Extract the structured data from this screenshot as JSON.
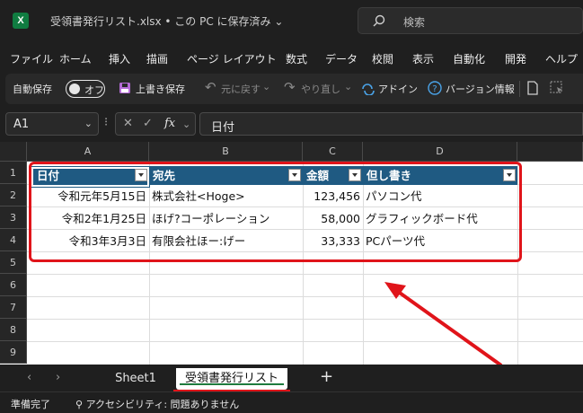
{
  "titlebar": {
    "app_icon": "X",
    "file_title": "受領書発行リスト.xlsx • この PC に保存済み ⌄",
    "search_placeholder": "検索"
  },
  "menu": [
    "ファイル",
    "ホーム",
    "挿入",
    "描画",
    "ページ レイアウト",
    "数式",
    "データ",
    "校閲",
    "表示",
    "自動化",
    "開発",
    "ヘルプ"
  ],
  "ribbon": {
    "autosave_label": "自動保存",
    "autosave_state": "オフ",
    "save_label": "上書き保存",
    "undo_label": "元に戻す",
    "redo_label": "やり直し",
    "addin_label": "アドイン",
    "version_label": "バージョン情報"
  },
  "formula_bar": {
    "name_box": "A1",
    "formula": "日付"
  },
  "grid": {
    "columns": [
      "A",
      "B",
      "C",
      "D"
    ],
    "rows": [
      "1",
      "2",
      "3",
      "4",
      "5",
      "6",
      "7",
      "8",
      "9"
    ],
    "table_headers": [
      "日付",
      "宛先",
      "金額",
      "但し書き"
    ],
    "table_rows": [
      [
        "令和元年5月15日",
        "株式会社<Hoge>",
        "123,456",
        "パソコン代"
      ],
      [
        "令和2年1月25日",
        "ほげ?コーポレーション",
        "58,000",
        "グラフィックボード代"
      ],
      [
        "令和3年3月3日",
        "有限会社ほー:げー",
        "33,333",
        "PCパーツ代"
      ]
    ]
  },
  "sheets": {
    "tabs": [
      "Sheet1",
      "受領書発行リスト"
    ],
    "active": "受領書発行リスト",
    "add": "+"
  },
  "status": {
    "ready": "準備完了",
    "accessibility": "アクセシビリティ: 問題ありません"
  },
  "colors": {
    "table_header": "#1f5a82",
    "highlight": "#e0141a",
    "excel_green": "#107c41"
  }
}
